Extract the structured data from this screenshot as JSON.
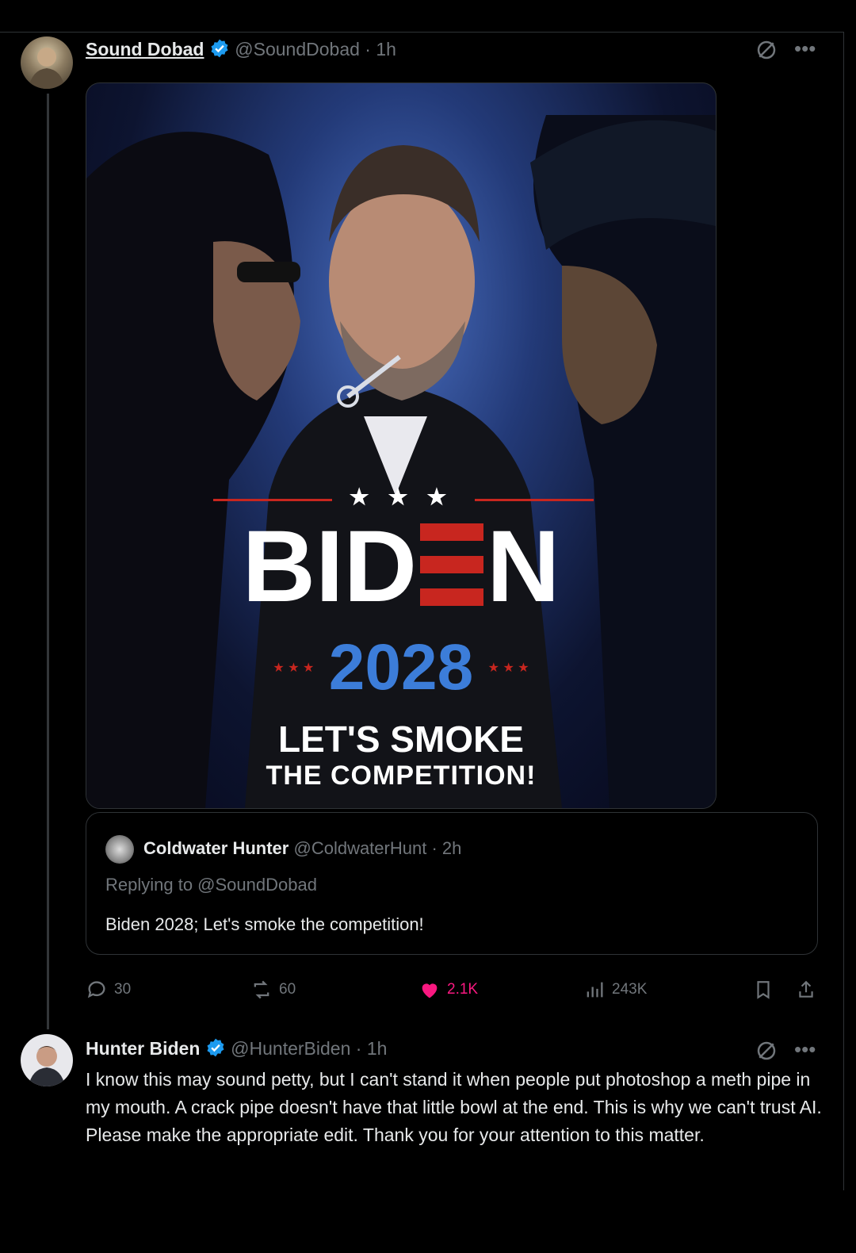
{
  "main_post": {
    "display_name": "Sound Dobad",
    "handle": "@SoundDobad",
    "time": "· 1h",
    "poster": {
      "word_left": "BID",
      "word_right": "N",
      "year": "2028",
      "slogan_line1": "LET'S SMOKE",
      "slogan_line2": "THE COMPETITION!",
      "stars": "★ ★ ★",
      "small_stars": "★ ★ ★"
    },
    "quote": {
      "display_name": "Coldwater Hunter",
      "handle": "@ColdwaterHunt",
      "time": "· 2h",
      "replying_to": "Replying to @SoundDobad",
      "text": "Biden 2028; Let's smoke the competition!"
    },
    "actions": {
      "replies": "30",
      "reposts": "60",
      "likes": "2.1K",
      "views": "243K"
    }
  },
  "reply_post": {
    "display_name": "Hunter Biden",
    "handle": "@HunterBiden",
    "time": "· 1h",
    "text": "I know this may sound petty, but I can't stand it when people put photoshop a meth pipe in my mouth. A crack pipe doesn't have that little bowl at the end. This is why we can't trust AI. Please make the appropriate edit. Thank you for your attention to this matter."
  },
  "colors": {
    "background": "#000000",
    "verified": "#1d9bf0",
    "like": "#f91880",
    "poster_blue": "#3c7dd9",
    "poster_red": "#c8261f"
  }
}
